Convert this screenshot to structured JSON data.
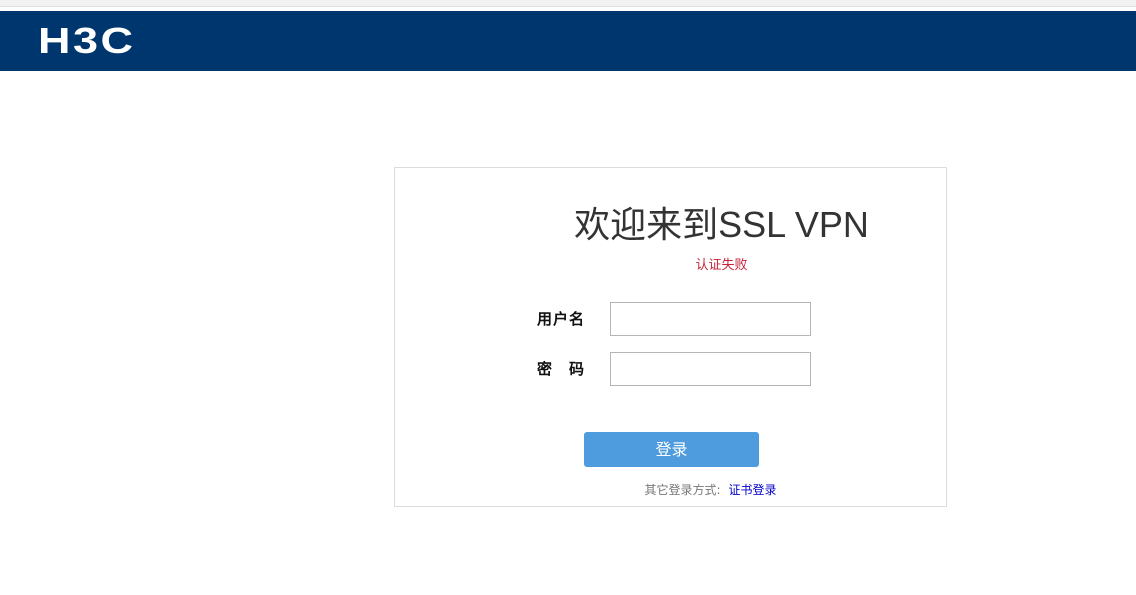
{
  "header": {
    "logo_text": "H3C",
    "background_color": "#00366e"
  },
  "login": {
    "title": "欢迎来到SSL VPN",
    "error_message": "认证失败",
    "username_label": "用户名",
    "password_label": "密　码",
    "username_value": "",
    "password_value": "",
    "submit_label": "登录",
    "other_methods_label": "其它登录方式:",
    "cert_login_label": "证书登录",
    "error_color": "#c8213a",
    "button_color": "#4e9cde",
    "link_color": "#0000cc"
  }
}
